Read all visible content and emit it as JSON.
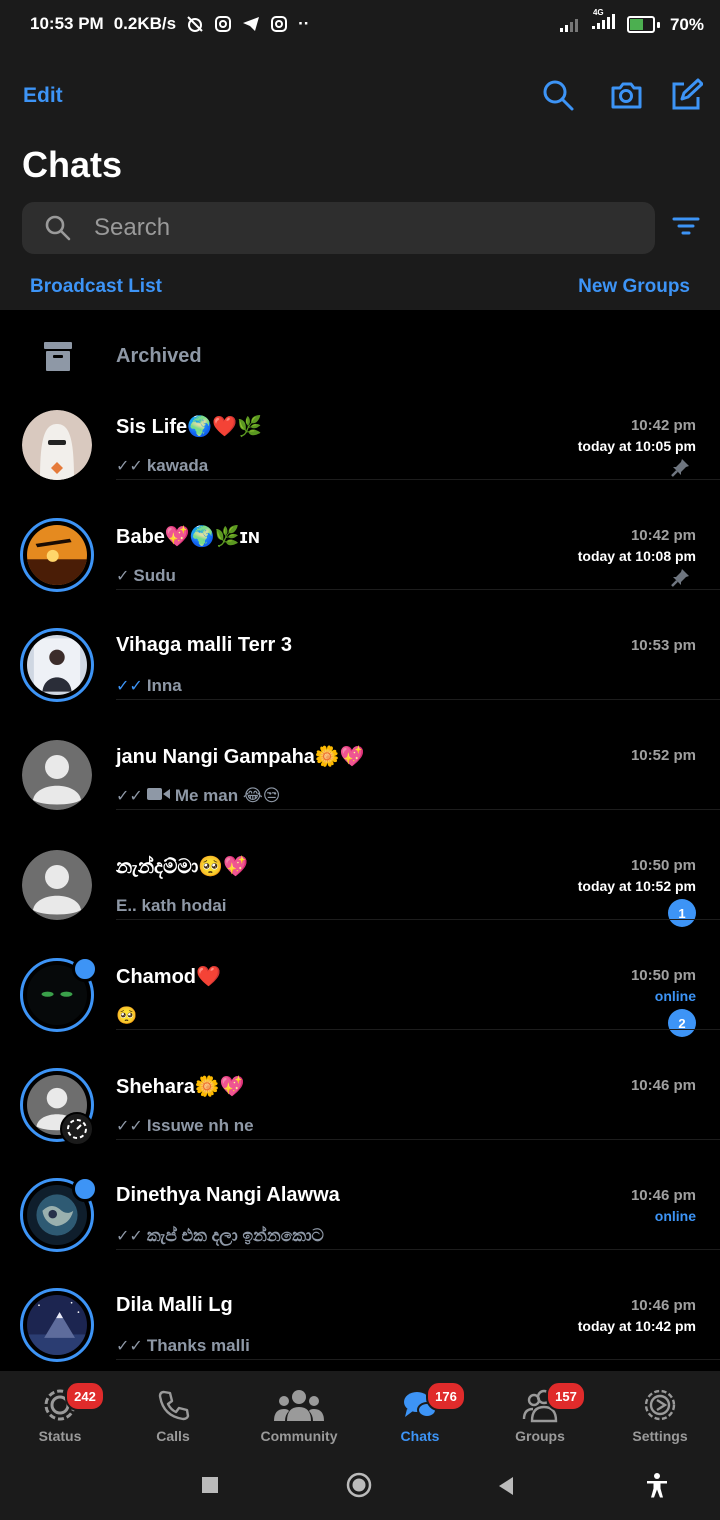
{
  "status_bar": {
    "time": "10:53 PM",
    "speed": "0.2KB/s",
    "network_label": "4G",
    "battery": "70%",
    "battery_level": 0.7
  },
  "header": {
    "edit_label": "Edit",
    "title": "Chats",
    "search_placeholder": "Search",
    "broadcast_label": "Broadcast List",
    "new_groups_label": "New Groups"
  },
  "archived": {
    "label": "Archived"
  },
  "chats": [
    {
      "name": "Sis Life🌍❤️🌿",
      "preview": "kawada",
      "check": "read-grey",
      "time": "10:42 pm",
      "sub": "today at 10:05 pm",
      "pinned": true,
      "unread": "",
      "ring": false,
      "dot": false,
      "avatar": "ghost"
    },
    {
      "name": "Babe💖🌍🌿ɪɴ",
      "preview": "Sudu",
      "check": "sent",
      "time": "10:42 pm",
      "sub": "today at 10:08 pm",
      "pinned": true,
      "unread": "",
      "ring": true,
      "dot": false,
      "avatar": "sunset"
    },
    {
      "name": "Vihaga malli Terr 3",
      "preview": "Inna",
      "check": "read-blue",
      "time": "10:53 pm",
      "sub": "",
      "pinned": false,
      "unread": "",
      "ring": true,
      "dot": false,
      "avatar": "person"
    },
    {
      "name": "janu Nangi Gampaha🌼💖",
      "preview": "Me man 😂😒",
      "check": "read-grey",
      "video": true,
      "time": "10:52 pm",
      "sub": "",
      "pinned": false,
      "unread": "",
      "ring": false,
      "dot": false,
      "avatar": "default"
    },
    {
      "name": "නැන්දම්මා🥺💖",
      "preview": "E.. kath hodai",
      "check": "",
      "time": "10:50 pm",
      "sub": "today at 10:52 pm",
      "pinned": false,
      "unread": "1",
      "ring": false,
      "dot": false,
      "avatar": "default"
    },
    {
      "name": "Chamod❤️",
      "preview": "🥺",
      "check": "",
      "time": "10:50 pm",
      "sub": "online",
      "pinned": false,
      "unread": "2",
      "ring": true,
      "dot": true,
      "avatar": "cat"
    },
    {
      "name": "Shehara🌼💖",
      "preview": "Issuwe nh ne",
      "check": "read-grey",
      "time": "10:46 pm",
      "sub": "",
      "pinned": false,
      "unread": "",
      "ring": true,
      "dot": false,
      "avatar": "default-timer"
    },
    {
      "name": "Dinethya Nangi Alawwa",
      "preview": "කැප් එක දලා ඉන්නකොට",
      "check": "read-grey",
      "time": "10:46 pm",
      "sub": "online",
      "pinned": false,
      "unread": "",
      "ring": true,
      "dot": true,
      "avatar": "earth"
    },
    {
      "name": "Dila Malli Lg",
      "preview": "Thanks malli",
      "check": "read-grey",
      "time": "10:46 pm",
      "sub": "today at 10:42 pm",
      "pinned": false,
      "unread": "",
      "ring": true,
      "dot": false,
      "avatar": "mountain"
    }
  ],
  "tabs": [
    {
      "label": "Status",
      "badge": "242",
      "icon": "status-icon",
      "active": false
    },
    {
      "label": "Calls",
      "badge": "",
      "icon": "phone-icon",
      "active": false
    },
    {
      "label": "Community",
      "badge": "",
      "icon": "community-icon",
      "active": false
    },
    {
      "label": "Chats",
      "badge": "176",
      "icon": "chats-icon",
      "active": true
    },
    {
      "label": "Groups",
      "badge": "157",
      "icon": "groups-icon",
      "active": false
    },
    {
      "label": "Settings",
      "badge": "",
      "icon": "gear-icon",
      "active": false
    }
  ],
  "colors": {
    "accent": "#3d94f6",
    "badge": "#e02b2b",
    "background": "#000000",
    "surface": "#1b1b1b"
  }
}
